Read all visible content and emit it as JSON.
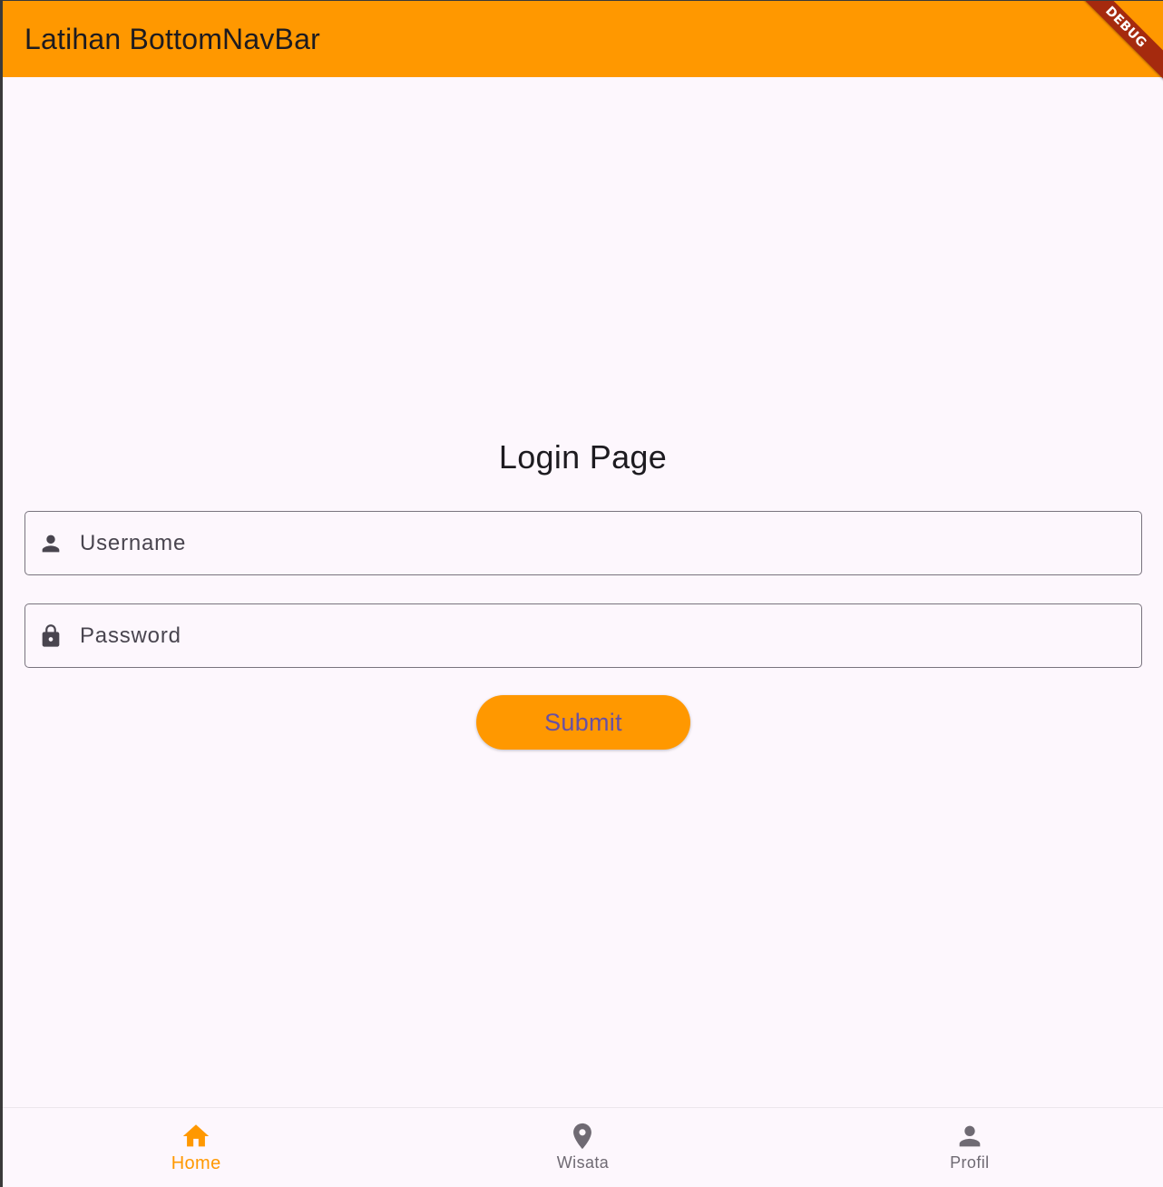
{
  "app_bar": {
    "title": "Latihan BottomNavBar",
    "debug_label": "DEBUG"
  },
  "login": {
    "title": "Login Page",
    "username": {
      "placeholder": "Username",
      "value": "",
      "icon": "person-icon"
    },
    "password": {
      "placeholder": "Password",
      "value": "",
      "icon": "lock-icon"
    },
    "submit_label": "Submit"
  },
  "bottom_nav": {
    "items": [
      {
        "label": "Home",
        "icon": "home-icon",
        "active": true
      },
      {
        "label": "Wisata",
        "icon": "location-pin-icon",
        "active": false
      },
      {
        "label": "Profil",
        "icon": "person-icon",
        "active": false
      }
    ]
  },
  "colors": {
    "primary": "#ff9800",
    "background": "#fdf7fd",
    "button_text": "#6750a4",
    "text_dark": "#1d1b20",
    "text_muted": "#49454f",
    "debug_banner": "#a52a0e"
  }
}
